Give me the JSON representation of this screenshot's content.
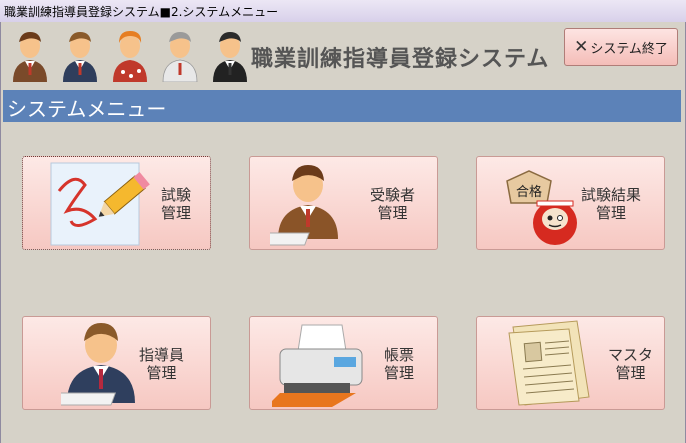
{
  "window": {
    "title": "職業訓練指導員登録システム■2.システムメニュー"
  },
  "header": {
    "app_title": "職業訓練指導員登録システム",
    "exit_button": {
      "icon": "close-icon",
      "label": "システム終了"
    },
    "avatars": [
      "person-icon",
      "person-icon",
      "person-icon",
      "person-icon",
      "person-icon"
    ]
  },
  "menu_bar": {
    "title": "システムメニュー"
  },
  "tiles": [
    {
      "line1": "試験",
      "line2": "管理",
      "icon": "pencil-icon"
    },
    {
      "line1": "受験者",
      "line2": "管理",
      "icon": "examinee-icon"
    },
    {
      "line1": "試験結果",
      "line2": "管理",
      "icon": "pass-daruma-icon",
      "plaque": "合格"
    },
    {
      "line1": "指導員",
      "line2": "管理",
      "icon": "instructor-icon"
    },
    {
      "line1": "帳票",
      "line2": "管理",
      "icon": "printer-icon"
    },
    {
      "line1": "マスタ",
      "line2": "管理",
      "icon": "document-icon"
    }
  ]
}
